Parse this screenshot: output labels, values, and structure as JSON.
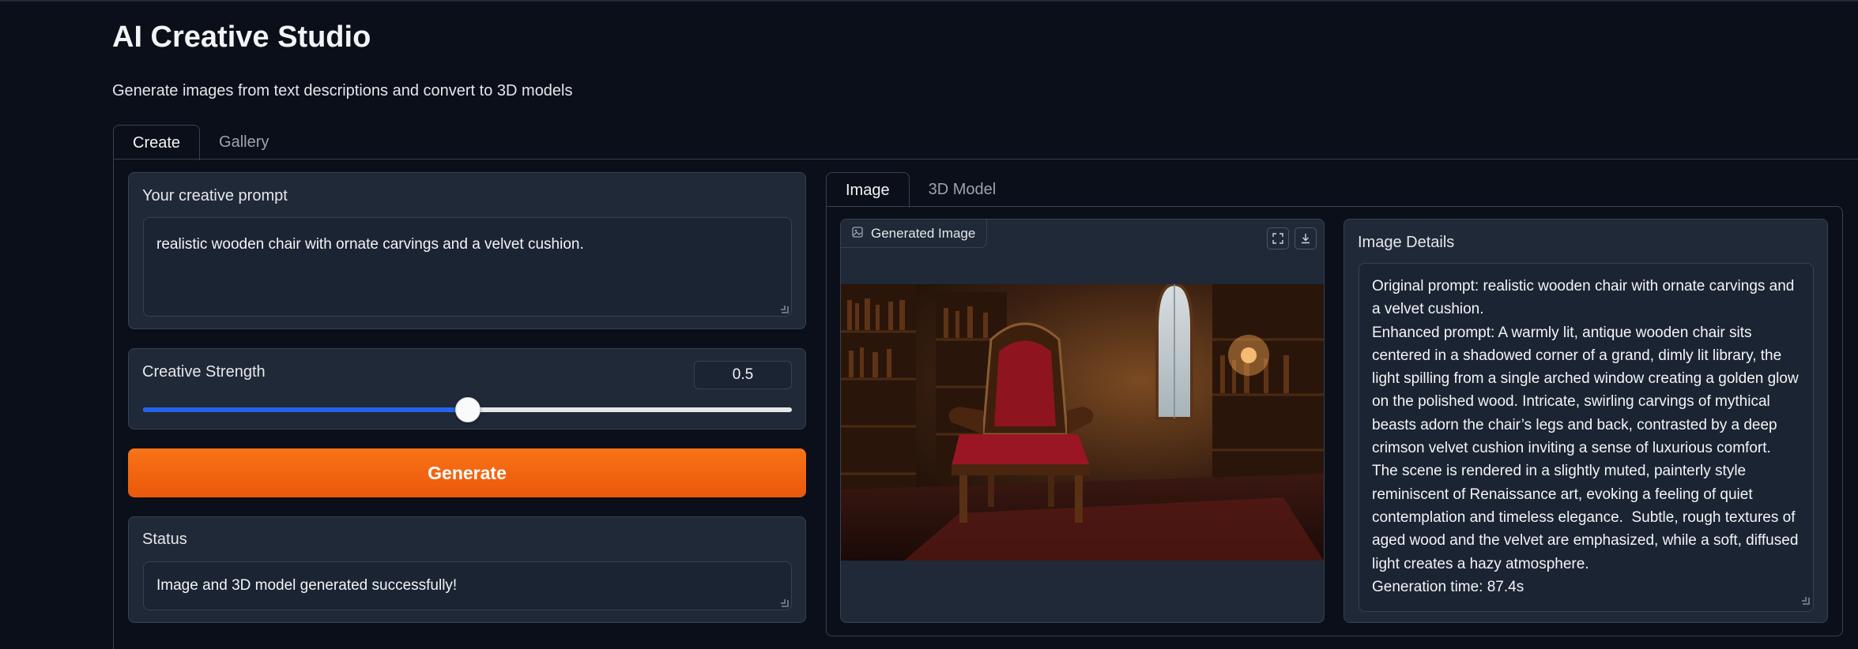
{
  "app": {
    "title": "AI Creative Studio",
    "subtitle": "Generate images from text descriptions and convert to 3D models"
  },
  "main_tabs": [
    {
      "label": "Create",
      "active": true
    },
    {
      "label": "Gallery",
      "active": false
    }
  ],
  "prompt": {
    "label": "Your creative prompt",
    "value": "realistic wooden chair with ornate carvings and a velvet cushion."
  },
  "strength": {
    "label": "Creative Strength",
    "value": "0.5",
    "fraction": 0.5
  },
  "generate_button": {
    "label": "Generate"
  },
  "status": {
    "label": "Status",
    "value": "Image and 3D model generated successfully!"
  },
  "output_tabs": [
    {
      "label": "Image",
      "active": true
    },
    {
      "label": "3D Model",
      "active": false
    }
  ],
  "image": {
    "label": "Generated Image"
  },
  "details": {
    "label": "Image Details",
    "text": "Original prompt: realistic wooden chair with ornate carvings and a velvet cushion.\nEnhanced prompt: A warmly lit, antique wooden chair sits centered in a shadowed corner of a grand, dimly lit library, the light spilling from a single arched window creating a golden glow on the polished wood. Intricate, swirling carvings of mythical beasts adorn the chair’s legs and back, contrasted by a deep crimson velvet cushion inviting a sense of luxurious comfort. The scene is rendered in a slightly muted, painterly style reminiscent of Renaissance art, evoking a feeling of quiet contemplation and timeless elegance.  Subtle, rough textures of aged wood and the velvet are emphasized, while a soft, diffused light creates a hazy atmosphere.\nGeneration time: 87.4s"
  },
  "colors": {
    "background": "#0b0f19",
    "panel": "#1f2937",
    "accent_orange": "#f97316",
    "slider_blue": "#2563eb"
  }
}
